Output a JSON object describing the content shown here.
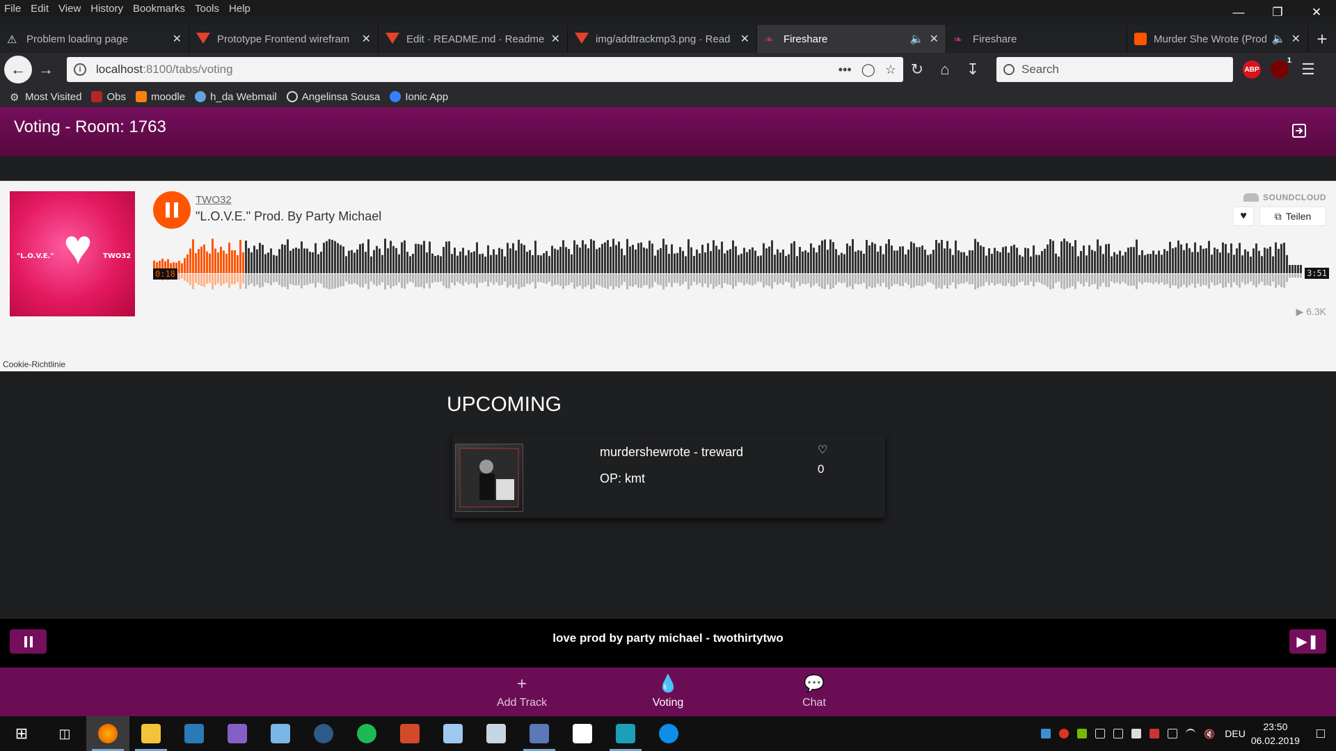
{
  "browser": {
    "menu": [
      "File",
      "Edit",
      "View",
      "History",
      "Bookmarks",
      "Tools",
      "Help"
    ],
    "tabs": [
      {
        "label": "Problem loading page",
        "icon": "warning-icon"
      },
      {
        "label": "Prototype Frontend wirefram",
        "icon": "gitlab-icon"
      },
      {
        "label": "Edit · README.md · Readme",
        "icon": "gitlab-icon"
      },
      {
        "label": "img/addtrackmp3.png · Read",
        "icon": "gitlab-icon"
      },
      {
        "label": "Fireshare",
        "icon": "fireshare-icon"
      },
      {
        "label": "Fireshare",
        "icon": "fireshare-icon"
      },
      {
        "label": "Murder She Wrote (Prod.",
        "icon": "soundcloud-icon"
      }
    ],
    "url": "localhost:8100/tabs/voting",
    "url_host": "localhost",
    "url_path": ":8100/tabs/voting",
    "search_placeholder": "Search",
    "ext_badge": "1",
    "ext_abp": "ABP",
    "bookmarks": [
      "Most Visited",
      "Obs",
      "moodle",
      "h_da Webmail",
      "Angelinsa Sousa",
      "Ionic App"
    ]
  },
  "app": {
    "title": "Voting - Room: 1763",
    "player": {
      "artist": "TWO32",
      "title": "\"L.O.V.E.\" Prod. By Party Michael",
      "brand": "SOUNDCLOUD",
      "share_label": "Teilen",
      "current_time": "0:18",
      "duration": "3:51",
      "plays": "6.3K",
      "progress": 0.078,
      "cookie_label": "Cookie-Richtlinie",
      "art_left_text": "\"L.O.V.E.\"",
      "art_right_text": "TWO32"
    },
    "upcoming": {
      "heading": "UPCOMING",
      "items": [
        {
          "title": "murdershewrote - treward",
          "op": "OP: kmt",
          "votes": "0"
        }
      ]
    },
    "now_playing": "love prod by party michael - twothirtytwo",
    "tabs": [
      {
        "label": "Add Track",
        "icon": "plus-icon"
      },
      {
        "label": "Voting",
        "icon": "flame-icon"
      },
      {
        "label": "Chat",
        "icon": "chat-icon"
      }
    ]
  },
  "taskbar": {
    "language": "DEU",
    "time": "23:50",
    "date": "06.02.2019"
  },
  "colors": {
    "accent": "#750e5c",
    "soundcloud": "#ff5500"
  }
}
